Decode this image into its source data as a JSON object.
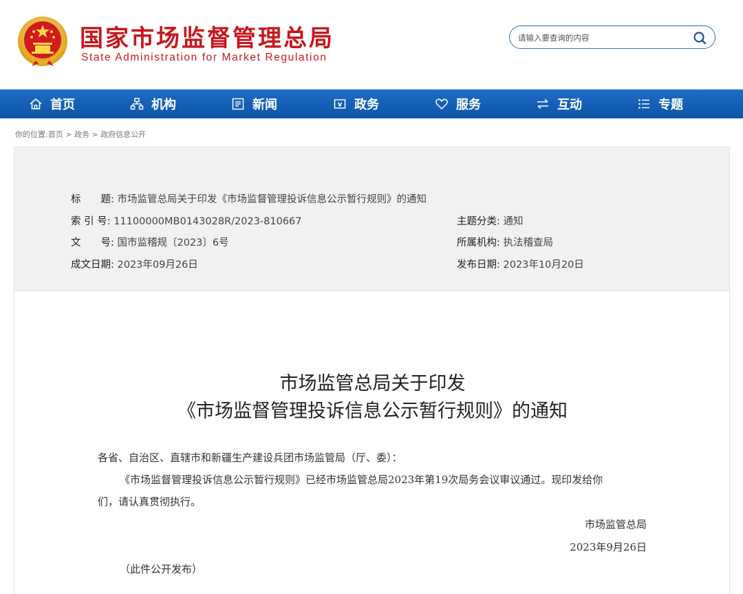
{
  "header": {
    "title": "国家市场监督管理总局",
    "subtitle": "State Administration for Market Regulation",
    "search": {
      "placeholder": "请输入要查询的内容"
    }
  },
  "nav": [
    {
      "label": "首页",
      "icon": "home-icon"
    },
    {
      "label": "机构",
      "icon": "org-chart-icon"
    },
    {
      "label": "新闻",
      "icon": "news-icon"
    },
    {
      "label": "政务",
      "icon": "government-icon"
    },
    {
      "label": "服务",
      "icon": "heart-icon"
    },
    {
      "label": "互动",
      "icon": "exchange-icon"
    },
    {
      "label": "专题",
      "icon": "list-icon"
    }
  ],
  "breadcrumb": {
    "prefix": "你的位置:",
    "items": [
      "首页",
      "政务",
      "政府信息公开"
    ],
    "separator": " > "
  },
  "meta": {
    "title_label": "标　　题:",
    "title_value": "市场监管总局关于印发《市场监督管理投诉信息公示暂行规则》的通知",
    "index_label": "索 引 号:",
    "index_value": "11100000MB0143028R/2023-810667",
    "topic_label": "主题分类:",
    "topic_value": "通知",
    "docno_label": "文　　号:",
    "docno_value": "国市监稽规〔2023〕6号",
    "org_label": "所属机构:",
    "org_value": "执法稽查局",
    "date_label": "成文日期:",
    "date_value": "2023年09月26日",
    "pubdate_label": "发布日期:",
    "pubdate_value": "2023年10月20日"
  },
  "document": {
    "title_line1": "市场监管总局关于印发",
    "title_line2": "《市场监督管理投诉信息公示暂行规则》的通知",
    "salutation": "各省、自治区、直辖市和新疆生产建设兵团市场监管局（厅、委）：",
    "para1_line1": "《市场监督管理投诉信息公示暂行规则》已经市场监管总局2023年第19次局务会议审议通过。现印发给你",
    "para1_line2": "们，请认真贯彻执行。",
    "signature": "市场监管总局",
    "sign_date": "2023年9月26日",
    "note": "（此件公开发布）"
  },
  "colors": {
    "brand_red": "#c8161d",
    "nav_blue": "#0c54a8",
    "panel_gray": "#f1f1f1"
  }
}
